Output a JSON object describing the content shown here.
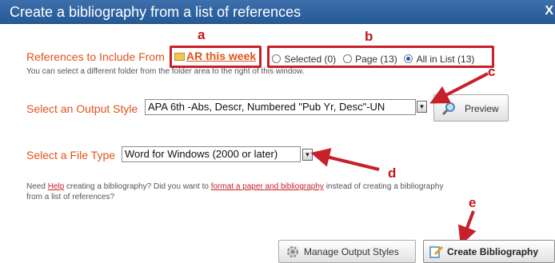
{
  "window": {
    "title": "Create a bibliography from a list of references",
    "close_glyph": "X"
  },
  "references": {
    "label": "References to Include From",
    "folder_name": "AR this week",
    "helper": "You can select a different folder from the folder area to the right of this window.",
    "radios": [
      {
        "label": "Selected (0)",
        "checked": false
      },
      {
        "label": "Page (13)",
        "checked": false
      },
      {
        "label": "All in List (13)",
        "checked": true
      }
    ]
  },
  "output_style": {
    "label": "Select an Output Style",
    "value": "APA 6th -Abs, Descr, Numbered \"Pub Yr, Desc\"-UN",
    "preview_label": "Preview"
  },
  "file_type": {
    "label": "Select a File Type",
    "value": "Word for Windows (2000 or later)"
  },
  "help": {
    "prefix": "Need ",
    "help_link": "Help",
    "middle": " creating a bibliography? Did you want to ",
    "format_link": "format a paper and bibliography",
    "suffix": " instead of creating a bibliography",
    "line2": "from a list of references?"
  },
  "buttons": {
    "manage": "Manage Output Styles",
    "create": "Create Bibliography"
  },
  "annotations": {
    "a": "a",
    "b": "b",
    "c": "c",
    "d": "d",
    "e": "e"
  },
  "colors": {
    "annotation": "#c8202a",
    "label": "#e0531c",
    "titlebar": "#2e64a1"
  },
  "icons": {
    "folder": "folder-icon",
    "preview": "magnifier-icon",
    "manage": "gear-icon",
    "create": "pencil-document-icon"
  }
}
